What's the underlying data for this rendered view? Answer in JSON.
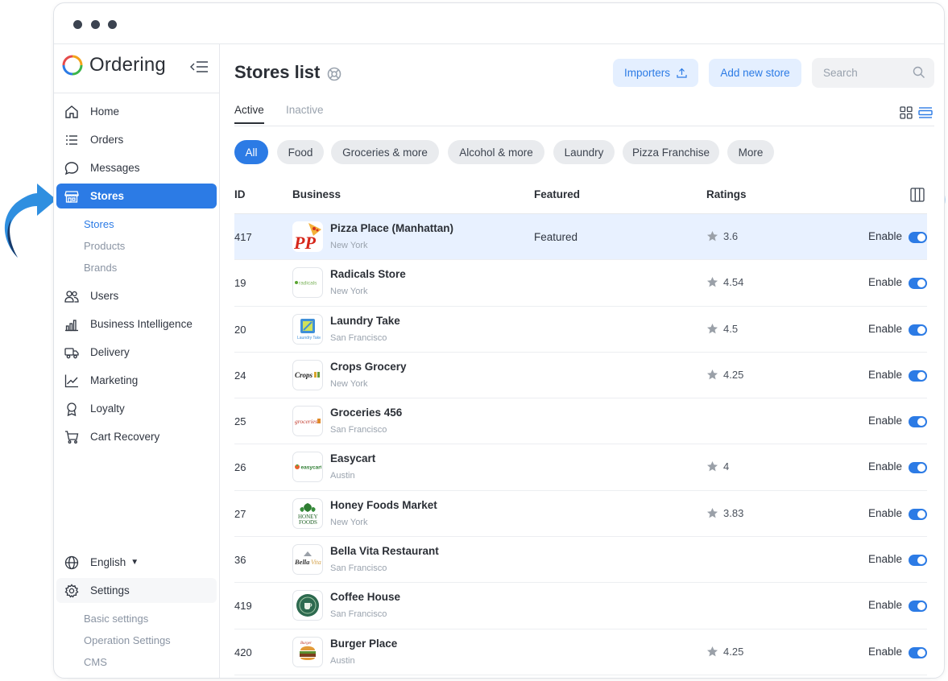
{
  "app": {
    "brand": "Ordering"
  },
  "sidebar": {
    "items": [
      {
        "label": "Home",
        "icon": "home-icon"
      },
      {
        "label": "Orders",
        "icon": "list-icon"
      },
      {
        "label": "Messages",
        "icon": "chat-icon"
      },
      {
        "label": "Stores",
        "icon": "store-icon",
        "active": true
      },
      {
        "label": "Users",
        "icon": "users-icon"
      },
      {
        "label": "Business Intelligence",
        "icon": "bar-chart-icon"
      },
      {
        "label": "Delivery",
        "icon": "truck-icon"
      },
      {
        "label": "Marketing",
        "icon": "line-chart-icon"
      },
      {
        "label": "Loyalty",
        "icon": "award-icon"
      },
      {
        "label": "Cart Recovery",
        "icon": "cart-icon"
      }
    ],
    "stores_sub": [
      "Stores",
      "Products",
      "Brands"
    ],
    "language": "English",
    "settings": {
      "label": "Settings",
      "sub": [
        "Basic settings",
        "Operation Settings",
        "CMS"
      ]
    }
  },
  "header": {
    "title": "Stores list",
    "importers_label": "Importers",
    "add_store_label": "Add new store",
    "search_placeholder": "Search"
  },
  "tabs": [
    "Active",
    "Inactive"
  ],
  "filters": [
    "All",
    "Food",
    "Groceries & more",
    "Alcohol & more",
    "Laundry",
    "Pizza Franchise",
    "More"
  ],
  "table": {
    "columns": [
      "ID",
      "Business",
      "Featured",
      "Ratings"
    ],
    "rows": [
      {
        "id": "417",
        "name": "Pizza Place (Manhattan)",
        "city": "New York",
        "featured": "Featured",
        "rating": "3.6",
        "status": "Enable",
        "logo": "pizza-logo"
      },
      {
        "id": "19",
        "name": "Radicals Store",
        "city": "New York",
        "featured": "",
        "rating": "4.54",
        "status": "Enable",
        "logo": "radicals-logo"
      },
      {
        "id": "20",
        "name": "Laundry Take",
        "city": "San Francisco",
        "featured": "",
        "rating": "4.5",
        "status": "Enable",
        "logo": "laundry-logo"
      },
      {
        "id": "24",
        "name": "Crops Grocery",
        "city": "New York",
        "featured": "",
        "rating": "4.25",
        "status": "Enable",
        "logo": "crops-logo"
      },
      {
        "id": "25",
        "name": "Groceries 456",
        "city": "San Francisco",
        "featured": "",
        "rating": "",
        "status": "Enable",
        "logo": "groceries-logo"
      },
      {
        "id": "26",
        "name": "Easycart",
        "city": "Austin",
        "featured": "",
        "rating": "4",
        "status": "Enable",
        "logo": "easycart-logo"
      },
      {
        "id": "27",
        "name": "Honey Foods Market",
        "city": "New York",
        "featured": "",
        "rating": "3.83",
        "status": "Enable",
        "logo": "honey-foods-logo"
      },
      {
        "id": "36",
        "name": "Bella Vita Restaurant",
        "city": "San Francisco",
        "featured": "",
        "rating": "",
        "status": "Enable",
        "logo": "bella-vita-logo"
      },
      {
        "id": "419",
        "name": "Coffee House",
        "city": "San Francisco",
        "featured": "",
        "rating": "",
        "status": "Enable",
        "logo": "coffee-logo"
      },
      {
        "id": "420",
        "name": "Burger Place",
        "city": "Austin",
        "featured": "",
        "rating": "4.25",
        "status": "Enable",
        "logo": "burger-logo"
      }
    ]
  },
  "colors": {
    "accent": "#2c7be5",
    "accent_soft": "#e4efff",
    "selected_row": "#e8f1ff",
    "arrow": "#2f8fe0"
  }
}
